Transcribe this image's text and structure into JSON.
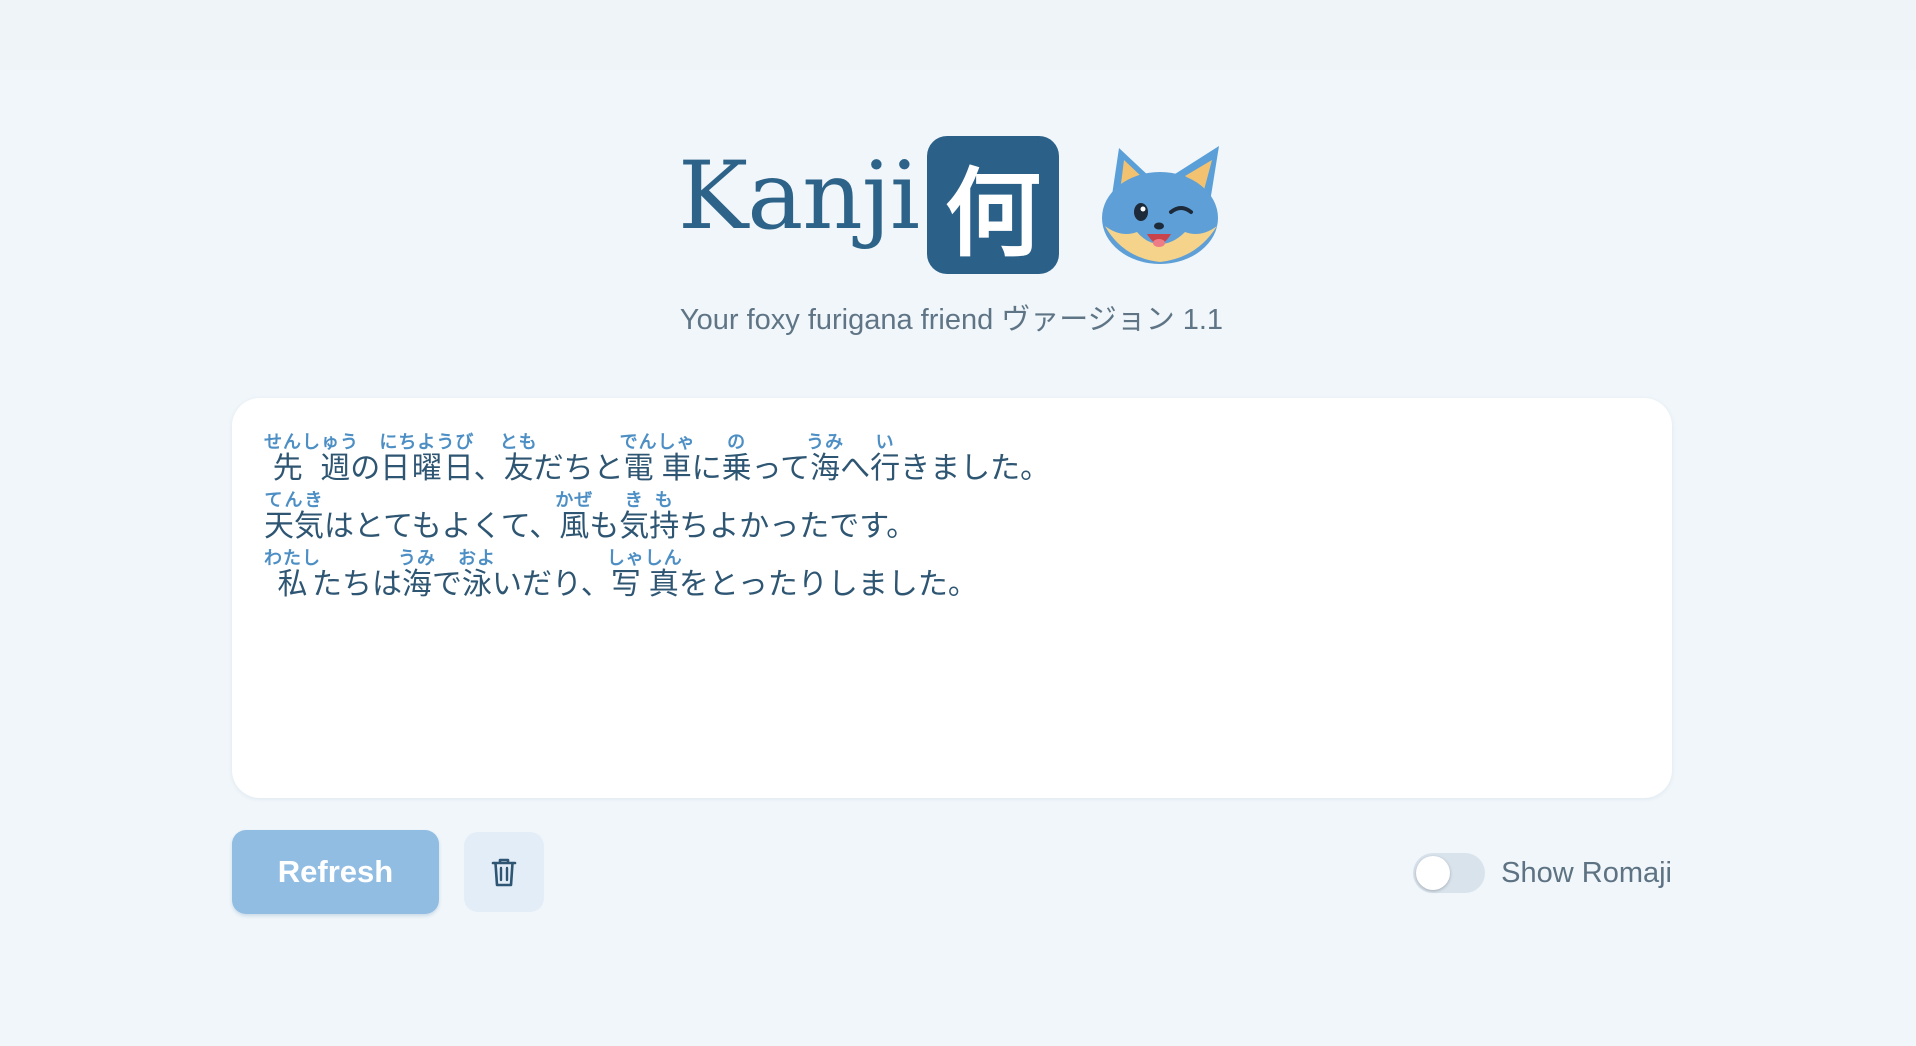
{
  "header": {
    "brand_word": "Kanji",
    "brand_kanji": "何",
    "tagline": "Your foxy furigana friend ヴァージョン 1.1",
    "mascot_icon": "fox-winking-icon"
  },
  "editor": {
    "lines": [
      [
        {
          "base": "先週",
          "reading": "せんしゅう"
        },
        {
          "text": "の"
        },
        {
          "base": "日曜日",
          "reading": "にちようび"
        },
        {
          "text": "、"
        },
        {
          "base": "友",
          "reading": "とも"
        },
        {
          "text": "だちと"
        },
        {
          "base": "電車",
          "reading": "でんしゃ"
        },
        {
          "text": "に"
        },
        {
          "base": "乗",
          "reading": "の"
        },
        {
          "text": "って"
        },
        {
          "base": "海",
          "reading": "うみ"
        },
        {
          "text": "へ"
        },
        {
          "base": "行",
          "reading": "い"
        },
        {
          "text": "きました。"
        }
      ],
      [
        {
          "base": "天気",
          "reading": "てんき"
        },
        {
          "text": "はとてもよくて、"
        },
        {
          "base": "風",
          "reading": "かぜ"
        },
        {
          "text": "も"
        },
        {
          "base": "気持",
          "reading": "きも"
        },
        {
          "text": "ちよかったです。"
        }
      ],
      [
        {
          "base": "私",
          "reading": "わたし"
        },
        {
          "text": "たちは"
        },
        {
          "base": "海",
          "reading": "うみ"
        },
        {
          "text": "で"
        },
        {
          "base": "泳",
          "reading": "およ"
        },
        {
          "text": "いだり、"
        },
        {
          "base": "写真",
          "reading": "しゃしん"
        },
        {
          "text": "をとったりしました。"
        }
      ]
    ]
  },
  "controls": {
    "refresh_label": "Refresh",
    "clear_icon": "trash-icon",
    "romaji_label": "Show Romaji",
    "romaji_enabled": false
  },
  "colors": {
    "background": "#f0f6fa",
    "brand": "#2b6189",
    "furigana": "#4d8fc4",
    "refresh_button": "#92bde3"
  }
}
